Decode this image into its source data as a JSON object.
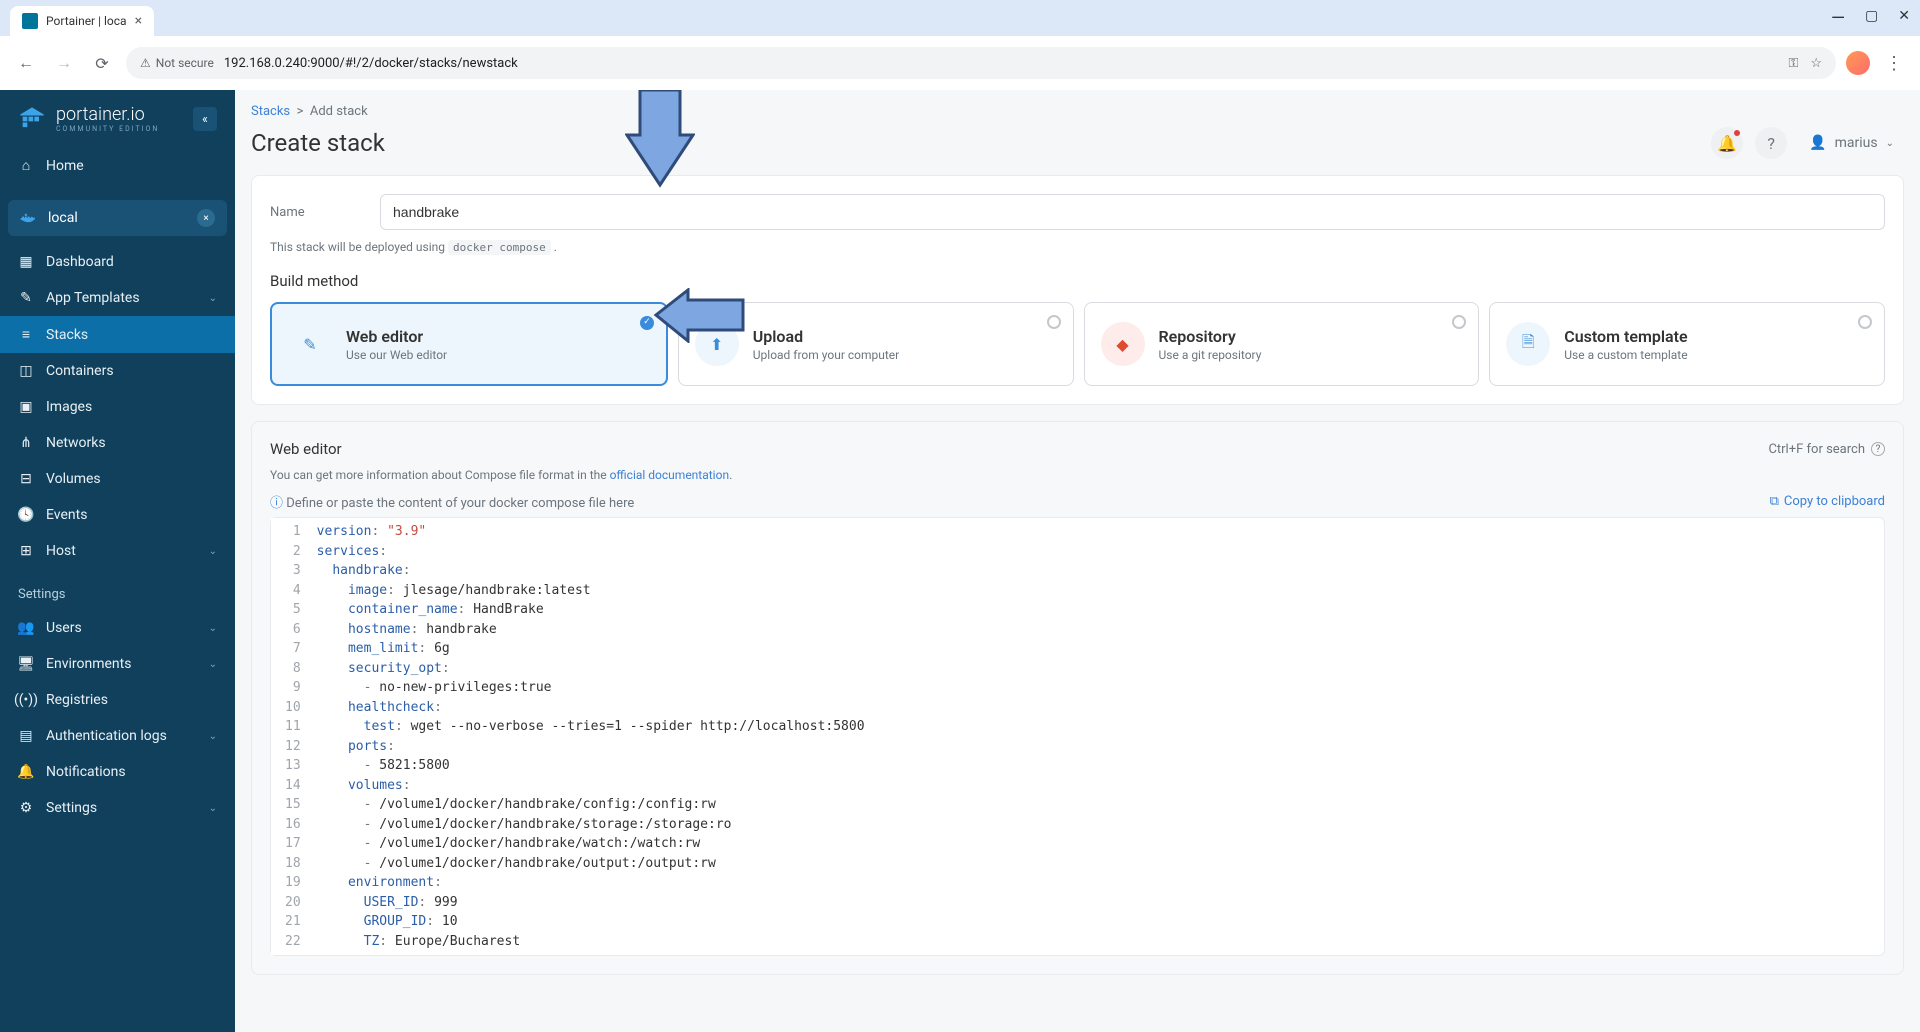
{
  "browser": {
    "tab_title": "Portainer | loca",
    "url": "192.168.0.240:9000/#!/2/docker/stacks/newstack",
    "not_secure": "Not secure"
  },
  "logo": {
    "name": "portainer.io",
    "edition": "COMMUNITY EDITION"
  },
  "sidebar": {
    "home": "Home",
    "env_name": "local",
    "items": [
      {
        "icon": "dashboard",
        "label": "Dashboard"
      },
      {
        "icon": "template",
        "label": "App Templates",
        "chev": true
      },
      {
        "icon": "stacks",
        "label": "Stacks",
        "active": true
      },
      {
        "icon": "containers",
        "label": "Containers"
      },
      {
        "icon": "images",
        "label": "Images"
      },
      {
        "icon": "networks",
        "label": "Networks"
      },
      {
        "icon": "volumes",
        "label": "Volumes"
      },
      {
        "icon": "events",
        "label": "Events"
      },
      {
        "icon": "host",
        "label": "Host",
        "chev": true
      }
    ],
    "settings_label": "Settings",
    "settings_items": [
      {
        "icon": "users",
        "label": "Users",
        "chev": true
      },
      {
        "icon": "env",
        "label": "Environments",
        "chev": true
      },
      {
        "icon": "registries",
        "label": "Registries"
      },
      {
        "icon": "auth",
        "label": "Authentication logs",
        "chev": true
      },
      {
        "icon": "notif",
        "label": "Notifications"
      },
      {
        "icon": "settings",
        "label": "Settings",
        "chev": true
      }
    ]
  },
  "breadcrumb": {
    "parent": "Stacks",
    "current": "Add stack"
  },
  "header": {
    "title": "Create stack",
    "user": "marius"
  },
  "form": {
    "name_label": "Name",
    "name_value": "handbrake",
    "deploy_hint_pre": "This stack will be deployed using ",
    "deploy_hint_code": "docker compose",
    "build_method_title": "Build method"
  },
  "methods": [
    {
      "title": "Web editor",
      "sub": "Use our Web editor",
      "selected": true
    },
    {
      "title": "Upload",
      "sub": "Upload from your computer"
    },
    {
      "title": "Repository",
      "sub": "Use a git repository"
    },
    {
      "title": "Custom template",
      "sub": "Use a custom template"
    }
  ],
  "editor": {
    "title": "Web editor",
    "search_hint": "Ctrl+F for search",
    "info_pre": "You can get more information about Compose file format in the ",
    "info_link": "official documentation",
    "paste_hint": "Define or paste the content of your docker compose file here",
    "copy_label": "Copy to clipboard",
    "code_lines": [
      {
        "n": 1,
        "indent": 0,
        "key": "version",
        "colon": true,
        "val": "\"3.9\""
      },
      {
        "n": 2,
        "indent": 0,
        "key": "services",
        "colon": true
      },
      {
        "n": 3,
        "indent": 2,
        "key": "handbrake",
        "colon": true
      },
      {
        "n": 4,
        "indent": 4,
        "key": "image",
        "colon": true,
        "plain": " jlesage/handbrake:latest"
      },
      {
        "n": 5,
        "indent": 4,
        "key": "container_name",
        "colon": true,
        "plain": " HandBrake"
      },
      {
        "n": 6,
        "indent": 4,
        "key": "hostname",
        "colon": true,
        "plain": " handbrake"
      },
      {
        "n": 7,
        "indent": 4,
        "key": "mem_limit",
        "colon": true,
        "plain": " 6g"
      },
      {
        "n": 8,
        "indent": 4,
        "key": "security_opt",
        "colon": true
      },
      {
        "n": 9,
        "indent": 6,
        "dash": true,
        "plain": " no-new-privileges:true"
      },
      {
        "n": 10,
        "indent": 4,
        "key": "healthcheck",
        "colon": true
      },
      {
        "n": 11,
        "indent": 6,
        "key": "test",
        "colon": true,
        "plain": " wget --no-verbose --tries=1 --spider http://localhost:5800"
      },
      {
        "n": 12,
        "indent": 4,
        "key": "ports",
        "colon": true
      },
      {
        "n": 13,
        "indent": 6,
        "dash": true,
        "plain": " 5821:5800"
      },
      {
        "n": 14,
        "indent": 4,
        "key": "volumes",
        "colon": true
      },
      {
        "n": 15,
        "indent": 6,
        "dash": true,
        "plain": " /volume1/docker/handbrake/config:/config:rw"
      },
      {
        "n": 16,
        "indent": 6,
        "dash": true,
        "plain": " /volume1/docker/handbrake/storage:/storage:ro"
      },
      {
        "n": 17,
        "indent": 6,
        "dash": true,
        "plain": " /volume1/docker/handbrake/watch:/watch:rw"
      },
      {
        "n": 18,
        "indent": 6,
        "dash": true,
        "plain": " /volume1/docker/handbrake/output:/output:rw"
      },
      {
        "n": 19,
        "indent": 4,
        "key": "environment",
        "colon": true
      },
      {
        "n": 20,
        "indent": 6,
        "key": "USER_ID",
        "colon": true,
        "plain": " 999"
      },
      {
        "n": 21,
        "indent": 6,
        "key": "GROUP_ID",
        "colon": true,
        "plain": " 10"
      },
      {
        "n": 22,
        "indent": 6,
        "key": "TZ",
        "colon": true,
        "plain": " Europe/Bucharest"
      }
    ]
  }
}
